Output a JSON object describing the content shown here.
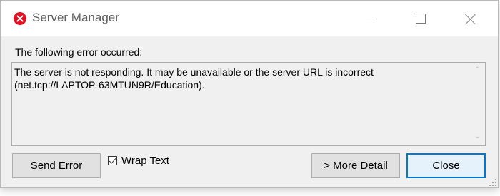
{
  "window": {
    "title": "Server Manager",
    "title_icon": "error-icon",
    "accent_error_color": "#e81123"
  },
  "controls": {
    "minimize_icon": "minimize-icon",
    "maximize_icon": "maximize-icon",
    "close_icon": "close-icon"
  },
  "dialog": {
    "error_label": "The following error occurred:",
    "message_lines": [
      "The server is not responding. It may be unavailable or the server URL is incorrect",
      "(net.tcp://LAPTOP-63MTUN9R/Education)."
    ]
  },
  "actions": {
    "send_error_label": "Send Error",
    "wrap_text_label": "Wrap Text",
    "wrap_text_checked": true,
    "more_detail_label": "> More Detail",
    "close_label": "Close",
    "default_button_color": "#0078d7"
  }
}
